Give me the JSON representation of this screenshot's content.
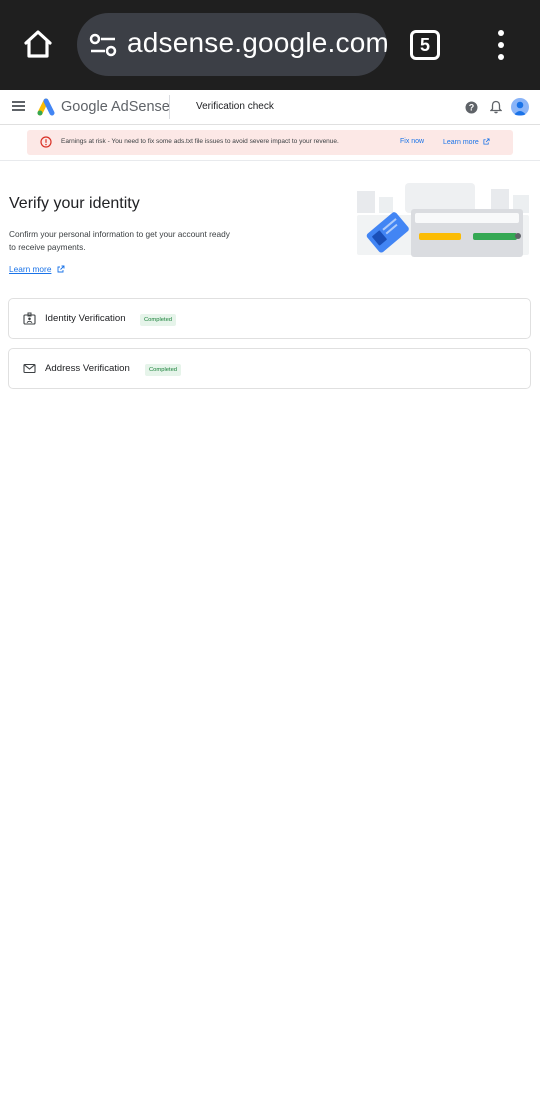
{
  "browser": {
    "url": "adsense.google.com/",
    "tab_count": "5",
    "icons": [
      "home-icon",
      "tune-icon",
      "tabs-icon",
      "more-vert-icon"
    ]
  },
  "header": {
    "brand": "Google AdSense",
    "page": "Verification check",
    "icons": [
      "menu-icon",
      "adsense-logo",
      "help-icon",
      "notifications-icon",
      "avatar"
    ]
  },
  "alert": {
    "text": "Earnings at risk - You need to fix some ads.txt file issues to avoid severe impact to your revenue.",
    "fix_label": "Fix now",
    "learn_label": "Learn more",
    "color": "#fce8e6"
  },
  "hero": {
    "title": "Verify your identity",
    "description": "Confirm your personal information to get your account ready to receive payments.",
    "learn_more": "Learn more"
  },
  "verifications": [
    {
      "label": "Identity Verification",
      "status": "Completed",
      "icon": "badge-id-icon"
    },
    {
      "label": "Address Verification",
      "status": "Completed",
      "icon": "mail-icon"
    }
  ],
  "colors": {
    "link": "#1a73e8",
    "success_bg": "#e6f4ea",
    "success_text": "#188038",
    "browser_bar": "#1f1f1f"
  }
}
